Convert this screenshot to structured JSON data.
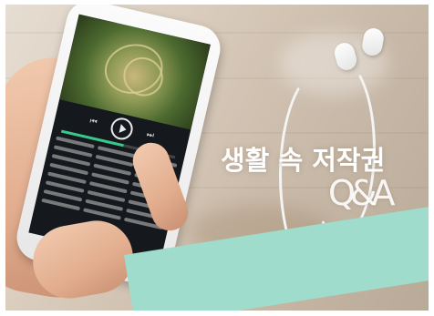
{
  "caption": {
    "title": "생활 속 저작권",
    "subtitle": "Q&A"
  },
  "player": {
    "icons": {
      "prev": "previous-track-icon",
      "play": "play-icon",
      "next": "next-track-icon"
    },
    "progress_fraction": 0.55,
    "accent_color": "#35c98c"
  },
  "colors": {
    "teal_band": "#9fdccb",
    "caption_text": "#ffffff"
  }
}
